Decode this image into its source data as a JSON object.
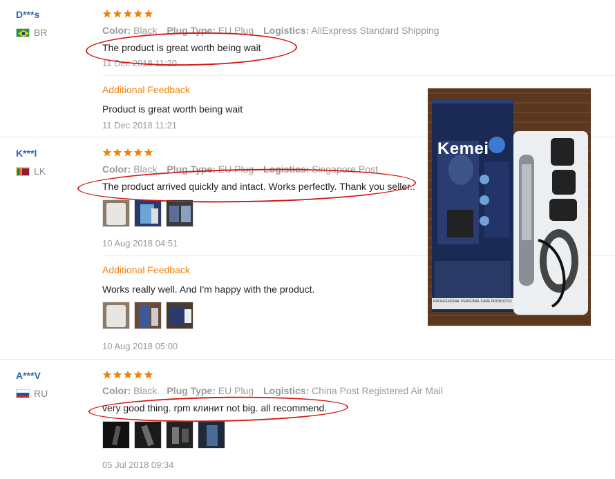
{
  "reviews": [
    {
      "user": "D***s",
      "country": "BR",
      "stars": 5,
      "meta": {
        "color_label": "Color:",
        "color_value": "Black",
        "plug_label": "Plug Type:",
        "plug_value": "EU Plug",
        "logistics_label": "Logistics:",
        "logistics_value": "AliExpress Standard Shipping"
      },
      "text": "The product is great worth being wait",
      "date": "11 Dec 2018 11:20",
      "additional": {
        "title": "Additional Feedback",
        "text": "Product is great worth being wait",
        "date": "11 Dec 2018 11:21"
      }
    },
    {
      "user": "K***l",
      "country": "LK",
      "stars": 5,
      "meta": {
        "color_label": "Color:",
        "color_value": "Black",
        "plug_label": "Plug Type:",
        "plug_value": "EU Plug",
        "logistics_label": "Logistics:",
        "logistics_value": "Singapore Post"
      },
      "text": "The product arrived quickly and intact. Works perfectly. Thank you seller..",
      "date": "10 Aug 2018 04:51",
      "additional": {
        "title": "Additional Feedback",
        "text": "Works really well. And I'm happy with the product.",
        "date": "10 Aug 2018 05:00"
      }
    },
    {
      "user": "A***V",
      "country": "RU",
      "stars": 5,
      "meta": {
        "color_label": "Color:",
        "color_value": "Black",
        "plug_label": "Plug Type:",
        "plug_value": "EU Plug",
        "logistics_label": "Logistics:",
        "logistics_value": "China Post Registered Air Mail"
      },
      "text": "very good thing. rpm клинит not big. all recommend.",
      "date": "05 Jul 2018 09:34"
    }
  ],
  "product_photo": {
    "brand": "Kemei",
    "model_strip": "PROFESSIONAL PERSONAL CARE PRODUCTS  MODEL:KM-5636"
  },
  "colors": {
    "username": "#2f66b3",
    "star": "#f0820c",
    "additional_feedback": "#f0820c",
    "annotation": "#d21a1a"
  }
}
